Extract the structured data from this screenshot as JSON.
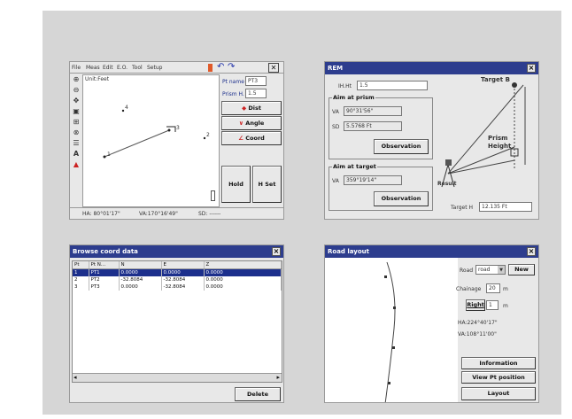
{
  "screen1": {
    "menu": [
      "File",
      "Meas",
      "Edit",
      "E.O.",
      "Tool",
      "Setup"
    ],
    "unit_label": "Unit:Feet",
    "pt_name_label": "Pt name",
    "pt_name_value": "PT3",
    "prism_h_label": "Prism H.",
    "prism_h_value": "1.5",
    "dist_label": "Dist",
    "angle_label": "Angle",
    "coord_label": "Coord",
    "hold_label": "Hold",
    "hset_label": "H Set",
    "status_ha": "HA: 80°01'17\"",
    "status_va": "VA:170°16'49\"",
    "status_sd": "SD: ------",
    "points": [
      "4",
      "3",
      "2",
      "1"
    ]
  },
  "screen2": {
    "title": "REM",
    "ih_label": "IH.Ht",
    "ih_value": "1.5",
    "aim_prism_title": "Aim at prism",
    "va_label": "VA",
    "va_prism_value": "90°31'56\"",
    "sd_label": "SD",
    "sd_value": "5.5768 Ft",
    "observation_label": "Observation",
    "aim_target_title": "Aim at target",
    "va_target_value": "359°19'14\"",
    "target_label": "Target B",
    "prism_height_label": "Prism\nHeight",
    "result_label": "Result",
    "target_h_label": "Target H",
    "target_h_value": "12.135 Ft"
  },
  "screen3": {
    "title": "Browse coord data",
    "columns": [
      "Pt",
      "Pt N...",
      "N",
      "E",
      "Z"
    ],
    "rows": [
      [
        "1",
        "PT1",
        "0.0000",
        "0.0000",
        "0.0000"
      ],
      [
        "2",
        "PT2",
        "-32.8084",
        "-32.8084",
        "0.0000"
      ],
      [
        "3",
        "PT3",
        "0.0000",
        "-32.8084",
        "0.0000"
      ]
    ],
    "delete_label": "Delete"
  },
  "screen4": {
    "title": "Road layout",
    "road_label": "Road",
    "road_value": "road",
    "new_label": "New",
    "chainage_label": "Chainage",
    "chainage_value": "20",
    "chainage_unit": "m",
    "right_label": "Right",
    "right_value": "1",
    "right_unit": "m",
    "ha_text": "HA:224°40'17\"",
    "va_text": "VA:108°11'00\"",
    "information_label": "Information",
    "view_pt_label": "View Pt position",
    "layout_label": "Layout"
  },
  "colors": {
    "panel": "#d6d6d6",
    "titlebar": "#2d3d8e",
    "selection": "#1c2f8c",
    "window": "#e8e8e8"
  }
}
